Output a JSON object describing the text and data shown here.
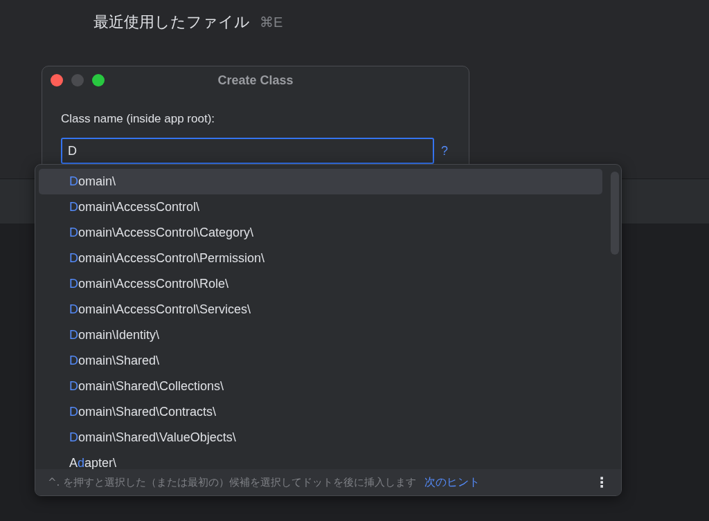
{
  "background_menu": [
    {
      "label": "最近使用したファイル",
      "shortcut": "⌘E"
    }
  ],
  "dialog": {
    "title": "Create Class",
    "field_label": "Class name (inside app root):",
    "value": "D",
    "help": "?"
  },
  "suggestions": [
    {
      "match": "D",
      "suffix": "omain\\",
      "selected": true
    },
    {
      "match": "D",
      "suffix": "omain\\AccessControl\\",
      "selected": false
    },
    {
      "match": "D",
      "suffix": "omain\\AccessControl\\Category\\",
      "selected": false
    },
    {
      "match": "D",
      "suffix": "omain\\AccessControl\\Permission\\",
      "selected": false
    },
    {
      "match": "D",
      "suffix": "omain\\AccessControl\\Role\\",
      "selected": false
    },
    {
      "match": "D",
      "suffix": "omain\\AccessControl\\Services\\",
      "selected": false
    },
    {
      "match": "D",
      "suffix": "omain\\Identity\\",
      "selected": false
    },
    {
      "match": "D",
      "suffix": "omain\\Shared\\",
      "selected": false
    },
    {
      "match": "D",
      "suffix": "omain\\Shared\\Collections\\",
      "selected": false
    },
    {
      "match": "D",
      "suffix": "omain\\Shared\\Contracts\\",
      "selected": false
    },
    {
      "match": "D",
      "suffix": "omain\\Shared\\ValueObjects\\",
      "selected": false
    },
    {
      "prefix": "A",
      "match": "d",
      "suffix": "apter\\",
      "selected": false
    }
  ],
  "footer": {
    "hint": "^. を押すと選択した（または最初の）候補を選択してドットを後に挿入します",
    "next_hint": "次のヒント",
    "more": "⋮"
  }
}
